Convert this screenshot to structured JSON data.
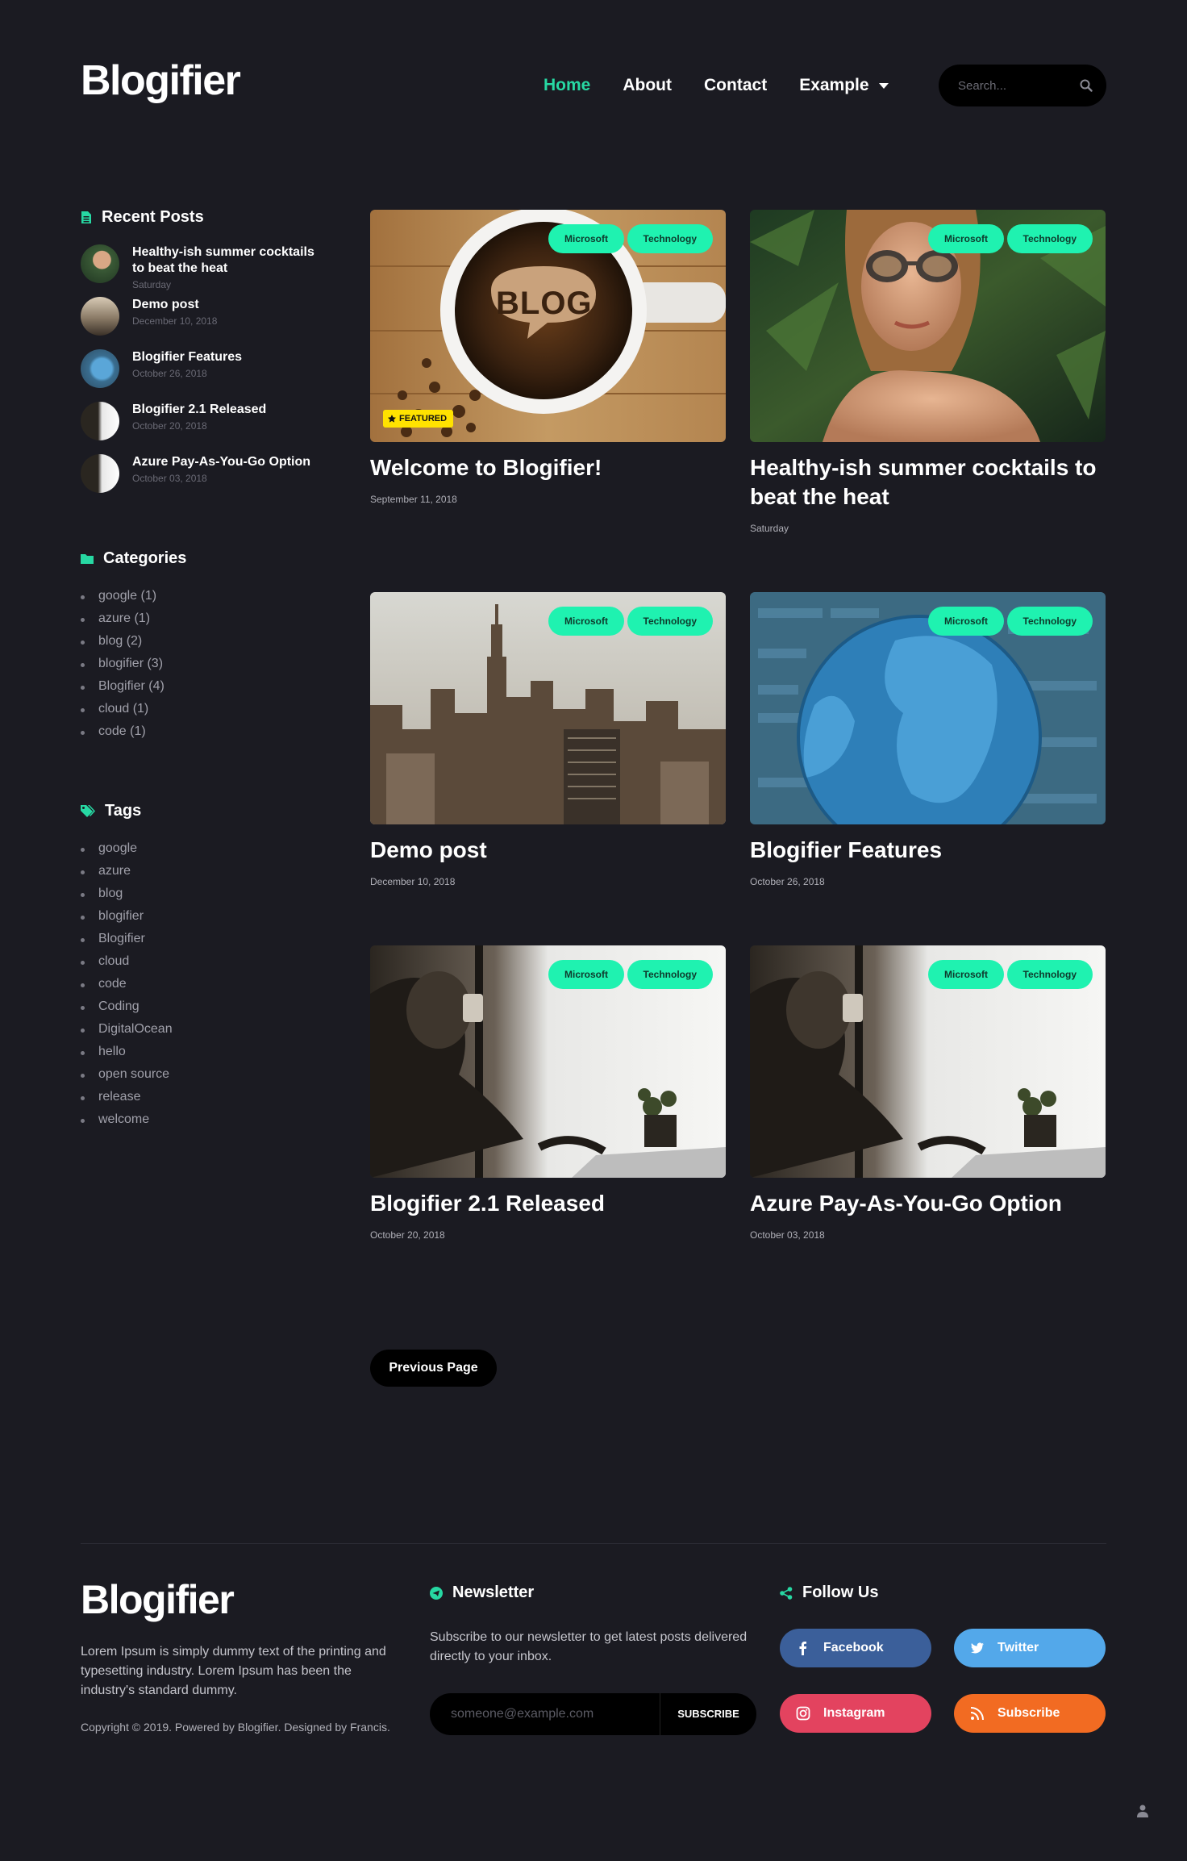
{
  "header": {
    "logo": "Blogifier",
    "nav": [
      {
        "label": "Home"
      },
      {
        "label": "About"
      },
      {
        "label": "Contact"
      },
      {
        "label": "Example"
      }
    ],
    "search_placeholder": "Search..."
  },
  "sidebar": {
    "recent_title": "Recent Posts",
    "recent": [
      {
        "title": "Healthy-ish summer cocktails to beat the heat",
        "date": "Saturday"
      },
      {
        "title": "Demo post",
        "date": "December 10, 2018"
      },
      {
        "title": "Blogifier Features",
        "date": "October 26, 2018"
      },
      {
        "title": "Blogifier 2.1 Released",
        "date": "October 20, 2018"
      },
      {
        "title": "Azure Pay-As-You-Go Option",
        "date": "October 03, 2018"
      }
    ],
    "categories_title": "Categories",
    "categories": [
      "google (1)",
      "azure (1)",
      "blog (2)",
      "blogifier (3)",
      "Blogifier (4)",
      "cloud (1)",
      "code (1)"
    ],
    "tags_title": "Tags",
    "tags": [
      "google",
      "azure",
      "blog",
      "blogifier",
      "Blogifier",
      "cloud",
      "code",
      "Coding",
      "DigitalOcean",
      "hello",
      "open source",
      "release",
      "welcome"
    ]
  },
  "posts": [
    {
      "title": "Welcome to Blogifier!",
      "date": "September 11, 2018",
      "badges": [
        "Microsoft",
        "Technology"
      ],
      "featured": "FEATURED"
    },
    {
      "title": "Healthy-ish summer cocktails to beat the heat",
      "date": "Saturday",
      "badges": [
        "Microsoft",
        "Technology"
      ]
    },
    {
      "title": "Demo post",
      "date": "December 10, 2018",
      "badges": [
        "Microsoft",
        "Technology"
      ]
    },
    {
      "title": "Blogifier Features",
      "date": "October 26, 2018",
      "badges": [
        "Microsoft",
        "Technology"
      ]
    },
    {
      "title": "Blogifier 2.1 Released",
      "date": "October 20, 2018",
      "badges": [
        "Microsoft",
        "Technology"
      ]
    },
    {
      "title": "Azure Pay-As-You-Go Option",
      "date": "October 03, 2018",
      "badges": [
        "Microsoft",
        "Technology"
      ]
    }
  ],
  "blog_image_text": "BLOG",
  "pager": {
    "previous": "Previous Page"
  },
  "footer": {
    "logo": "Blogifier",
    "about": "Lorem Ipsum is simply dummy text of the printing and typesetting industry. Lorem Ipsum has been the industry's standard dummy.",
    "copyright": "Copyright © 2019. Powered by Blogifier. Designed by Francis.",
    "newsletter_title": "Newsletter",
    "newsletter_text": "Subscribe to our newsletter to get latest posts delivered directly to your inbox.",
    "email_placeholder": "someone@example.com",
    "subscribe_label": "SUBSCRIBE",
    "follow_title": "Follow Us",
    "social": [
      {
        "label": "Facebook",
        "icon": "facebook-icon"
      },
      {
        "label": "Twitter",
        "icon": "twitter-icon"
      },
      {
        "label": "Instagram",
        "icon": "instagram-icon"
      },
      {
        "label": "Subscribe",
        "icon": "rss-icon"
      }
    ]
  },
  "colors": {
    "background": "#1b1b22",
    "accent": "#27d8a3",
    "badge": "#1ff2b0",
    "featured": "#ffe200",
    "facebook": "#3b5f9a",
    "twitter": "#53a8ea",
    "instagram": "#e3435f",
    "rss": "#f26b22"
  }
}
